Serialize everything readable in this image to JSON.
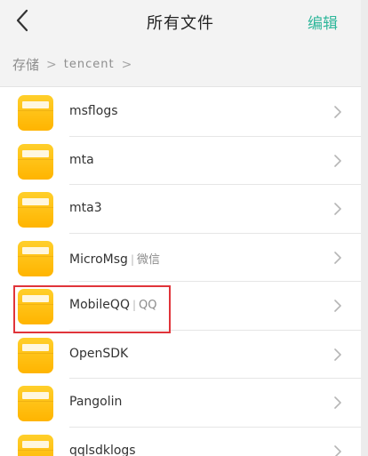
{
  "header": {
    "title": "所有文件",
    "edit_label": "编辑",
    "back_icon": "back-arrow-icon",
    "accent_color": "#2fb79b"
  },
  "breadcrumb": {
    "root": "存储",
    "path": "tencent",
    "separator": ">"
  },
  "files": [
    {
      "name": "msflogs",
      "note": ""
    },
    {
      "name": "mta",
      "note": ""
    },
    {
      "name": "mta3",
      "note": ""
    },
    {
      "name": "MicroMsg",
      "note": "微信"
    },
    {
      "name": "MobileQQ",
      "note": "QQ"
    },
    {
      "name": "OpenSDK",
      "note": ""
    },
    {
      "name": "Pangolin",
      "note": ""
    },
    {
      "name": "qqlsdklogs",
      "note": ""
    }
  ],
  "highlight_color": "#e0343a"
}
